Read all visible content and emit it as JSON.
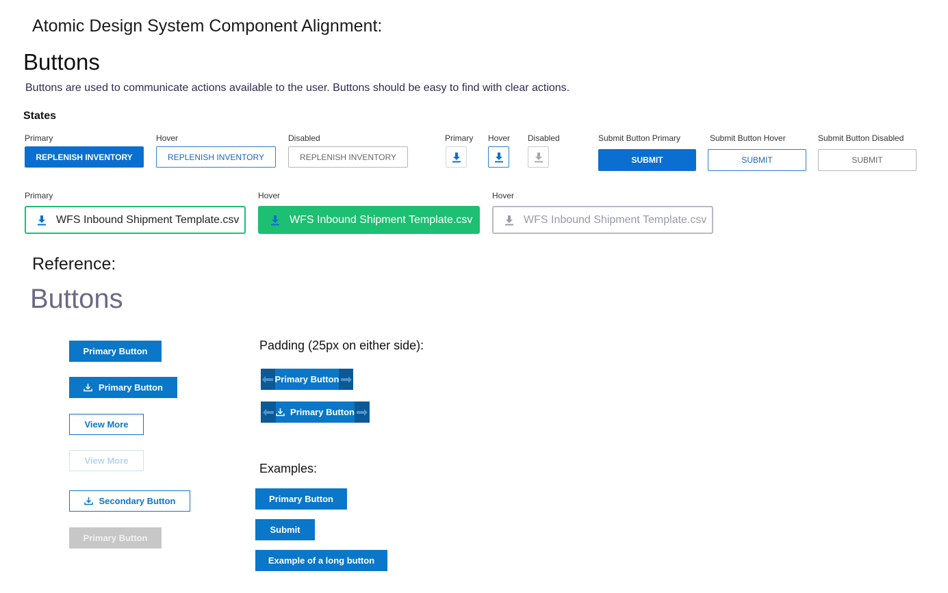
{
  "header": {
    "title": "Atomic Design System Component Alignment:",
    "section_title": "Buttons",
    "description": "Buttons are used to communicate actions available to the user. Buttons should be easy to find with clear actions.",
    "states_label": "States"
  },
  "states_row1": {
    "replenish": {
      "primary_label": "Primary",
      "hover_label": "Hover",
      "disabled_label": "Disabled",
      "button_text": "REPLENISH INVENTORY"
    },
    "icon_buttons": {
      "primary_label": "Primary",
      "hover_label": "Hover",
      "disabled_label": "Disabled",
      "icon": "download-icon"
    },
    "submit": {
      "primary_label": "Submit Button Primary",
      "hover_label": "Submit Button Hover",
      "disabled_label": "Submit Button Disabled",
      "button_text": "SUBMIT"
    }
  },
  "states_row2": {
    "primary_label": "Primary",
    "hover_label": "Hover",
    "third_label": "Hover",
    "file_name": "WFS Inbound Shipment Template.csv",
    "icon": "download-icon"
  },
  "reference": {
    "label": "Reference:",
    "title": "Buttons",
    "left": {
      "primary": "Primary Button",
      "primary_icon": "Primary Button",
      "view_more": "View More",
      "view_more_disabled": "View More",
      "secondary_icon": "Secondary Button",
      "primary_disabled": "Primary Button"
    },
    "padding": {
      "heading": "Padding (25px on either side):",
      "btn1": "Primary Button",
      "btn2": "Primary Button"
    },
    "examples": {
      "heading": "Examples:",
      "btn1": "Primary Button",
      "btn2": "Submit",
      "btn3": "Example of a long button"
    }
  },
  "colors": {
    "primary_blue": "#0a6fd0",
    "reference_blue": "#0a77c8",
    "green": "#1dbf73"
  }
}
